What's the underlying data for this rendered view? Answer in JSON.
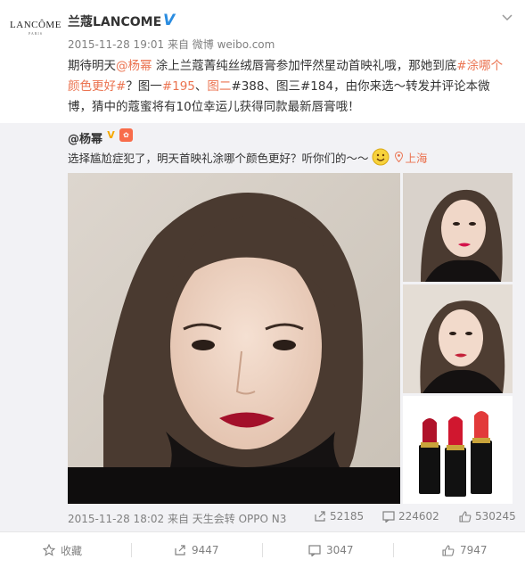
{
  "post": {
    "logo_text": "LANCÔME",
    "logo_subtext": "PARIS",
    "user_name": "兰蔻LANCOME",
    "timestamp": "2015-11-28 19:01",
    "source": "来自 微博 weibo.com",
    "text_parts": [
      {
        "t": "期待明天",
        "hl": false
      },
      {
        "t": "@杨幂",
        "hl": true
      },
      {
        "t": " 涂上兰蔻菁纯丝绒唇膏参加怦然星动首映礼哦，那她到底",
        "hl": false
      },
      {
        "t": "#涂哪个颜色更好#",
        "hl": true
      },
      {
        "t": "？图一",
        "hl": false
      },
      {
        "t": "#195",
        "hl": true
      },
      {
        "t": "、",
        "hl": false
      },
      {
        "t": "图二",
        "hl": true
      },
      {
        "t": "#388、图三#184，由你来选～转发并评论本微博，猜中的蔻蜜将有10位幸运儿获得同款最新唇膏哦！",
        "hl": false
      }
    ]
  },
  "repost": {
    "user": "@杨幂",
    "text": "选择尴尬症犯了，明天首映礼涂哪个颜色更好？听你们的～～",
    "location": "上海",
    "timestamp": "2015-11-28 18:02",
    "source": "来自 天生会转 OPPO N3",
    "reposts": "52185",
    "comments": "224602",
    "likes": "530245"
  },
  "footer": {
    "favorite": "收藏",
    "reposts": "9447",
    "comments": "3047",
    "likes": "7947"
  },
  "colors": {
    "highlight": "#eb7350",
    "verified": "#2a8ce0",
    "meta_text": "#808080",
    "repost_bg": "#f2f2f5"
  }
}
